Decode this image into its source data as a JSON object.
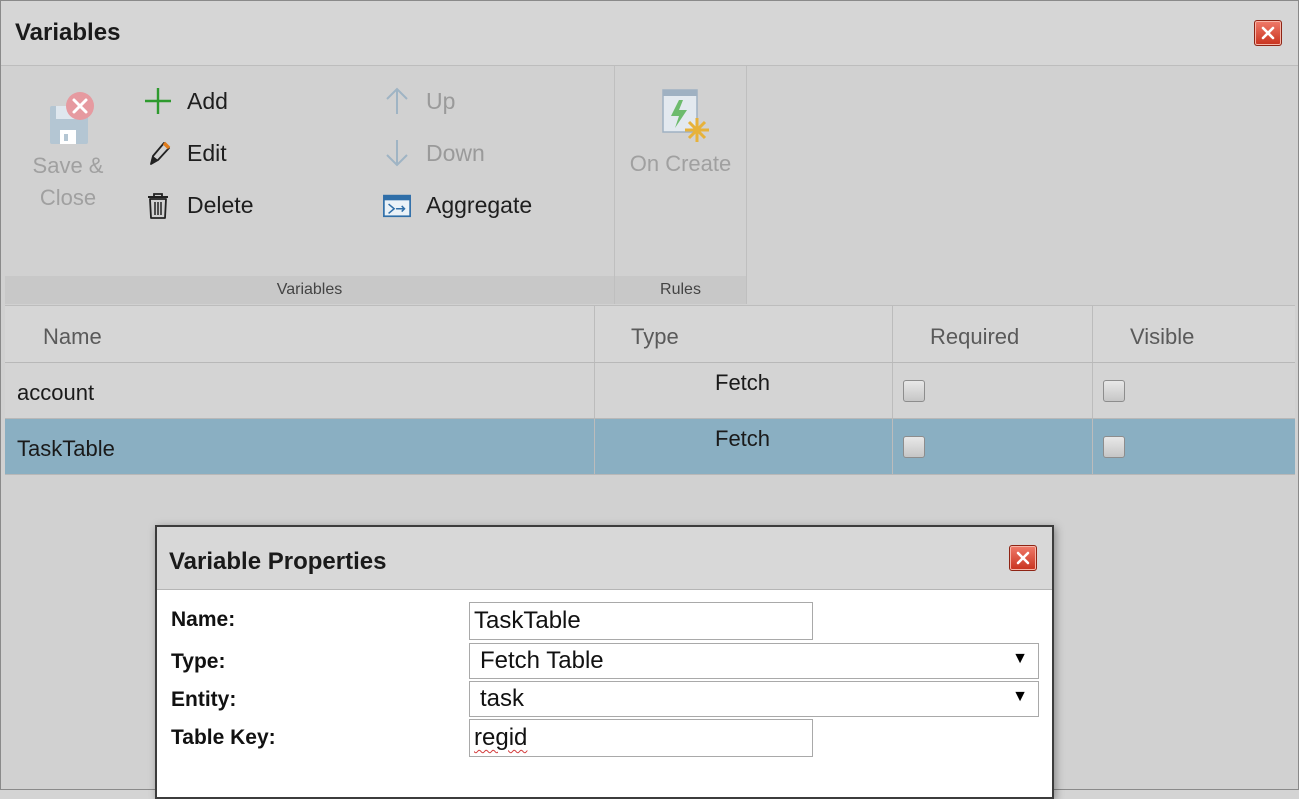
{
  "window": {
    "title": "Variables"
  },
  "ribbon": {
    "save_close": "Save &\nClose",
    "save_line1": "Save &",
    "save_line2": "Close",
    "add": "Add",
    "edit": "Edit",
    "delete": "Delete",
    "up": "Up",
    "down": "Down",
    "aggregate": "Aggregate",
    "on_create": "On Create",
    "group_variables": "Variables",
    "group_rules": "Rules"
  },
  "grid": {
    "columns": [
      "Name",
      "Type",
      "Required",
      "Visible"
    ],
    "rows": [
      {
        "name": "account",
        "type": "Fetch",
        "required": false,
        "visible": false,
        "selected": false
      },
      {
        "name": "TaskTable",
        "type": "Fetch",
        "required": false,
        "visible": false,
        "selected": true
      }
    ]
  },
  "dialog": {
    "title": "Variable Properties",
    "fields": {
      "name_label": "Name:",
      "name_value": "TaskTable",
      "type_label": "Type:",
      "type_value": "Fetch Table",
      "entity_label": "Entity:",
      "entity_value": "task",
      "table_key_label": "Table Key:",
      "table_key_value": "regid"
    }
  },
  "colors": {
    "selected_row": "#8aafc2",
    "add_icon": "#2e9a2e",
    "close_button": "#d9452e"
  },
  "icons": {
    "save": "floppy-disk-icon",
    "add": "plus-icon",
    "edit": "pencil-icon",
    "delete": "trash-icon",
    "up": "arrow-up-icon",
    "down": "arrow-down-icon",
    "aggregate": "aggregate-icon",
    "on_create": "on-create-rule-icon",
    "close": "close-icon"
  }
}
